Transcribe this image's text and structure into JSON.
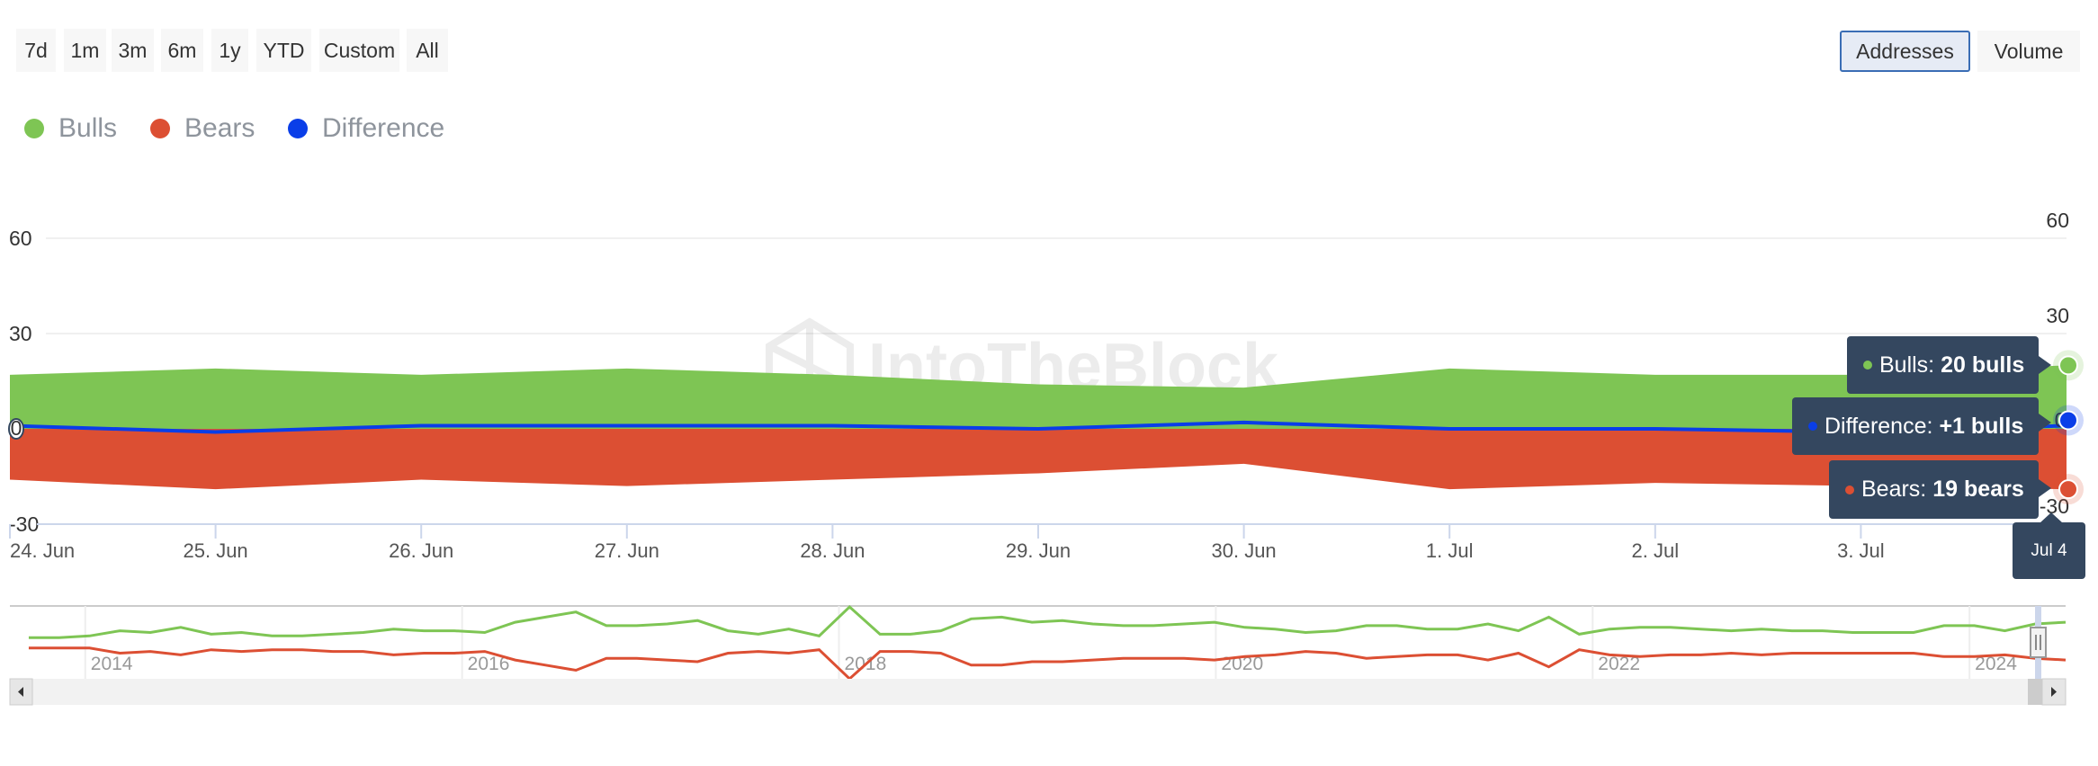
{
  "range_buttons": [
    {
      "label": "7d"
    },
    {
      "label": "1m"
    },
    {
      "label": "3m"
    },
    {
      "label": "6m"
    },
    {
      "label": "1y"
    },
    {
      "label": "YTD"
    },
    {
      "label": "Custom"
    },
    {
      "label": "All"
    }
  ],
  "mode_toggle": {
    "addresses_label": "Addresses",
    "volume_label": "Volume",
    "selected": "Addresses"
  },
  "colors": {
    "bulls": "#7ec554",
    "bears": "#dc4f33",
    "difference": "#0a3ee8",
    "tooltip_bg": "#34475f"
  },
  "legend": [
    {
      "name": "Bulls",
      "color": "#7ec554"
    },
    {
      "name": "Bears",
      "color": "#dc4f33"
    },
    {
      "name": "Difference",
      "color": "#0a3ee8"
    }
  ],
  "watermark": "IntoTheBlock",
  "tooltip": {
    "date": "Jul 4",
    "bulls_label": "Bulls:",
    "bulls_value": "20 bulls",
    "difference_label": "Difference:",
    "difference_value": "+1 bulls",
    "bears_label": "Bears:",
    "bears_value": "19 bears"
  },
  "chart_data": {
    "type": "area",
    "title": "",
    "xlabel": "",
    "ylabel": "",
    "x": [
      "24. Jun",
      "25. Jun",
      "26. Jun",
      "27. Jun",
      "28. Jun",
      "29. Jun",
      "30. Jun",
      "1. Jul",
      "2. Jul",
      "3. Jul",
      "4. Jul"
    ],
    "x_tick_labels": [
      "24. Jun",
      "25. Jun",
      "26. Jun",
      "27. Jun",
      "28. Jun",
      "29. Jun",
      "30. Jun",
      "1. Jul",
      "2. Jul",
      "3. Jul"
    ],
    "series": [
      {
        "name": "Bulls",
        "type": "area",
        "values": [
          17,
          19,
          17,
          19,
          17,
          14,
          13,
          19,
          17,
          17,
          20
        ]
      },
      {
        "name": "Bears",
        "type": "area",
        "values": [
          -16,
          -19,
          -16,
          -18,
          -16,
          -14,
          -11,
          -19,
          -17,
          -18,
          -19
        ]
      },
      {
        "name": "Difference",
        "type": "line",
        "values": [
          1,
          -1,
          1,
          1,
          1,
          0,
          2,
          0,
          0,
          -1,
          1
        ]
      }
    ],
    "y_ticks": [
      60,
      30,
      0,
      -30
    ],
    "ylim": [
      -30,
      60
    ],
    "right_axis_ticks": [
      60,
      30,
      0,
      -30
    ],
    "grid": true,
    "legend_position": "top-left",
    "navigator": {
      "year_labels": [
        "2014",
        "2016",
        "2018",
        "2020",
        "2022",
        "2024"
      ],
      "x_range": [
        2013.7,
        2024.51
      ],
      "bulls_approx": [
        2,
        2,
        3,
        6,
        5,
        8,
        4,
        5,
        3,
        3,
        4,
        5,
        7,
        6,
        6,
        5,
        11,
        14,
        17,
        9,
        9,
        10,
        12,
        6,
        4,
        7,
        3,
        20,
        4,
        4,
        6,
        13,
        14,
        11,
        12,
        10,
        9,
        9,
        10,
        11,
        8,
        7,
        5,
        6,
        9,
        9,
        7,
        7,
        10,
        6,
        14,
        4,
        7,
        8,
        8,
        7,
        6,
        7,
        6,
        6,
        5,
        5,
        5,
        9,
        9,
        6,
        10,
        11
      ],
      "bears_approx": [
        -2,
        -2,
        -2,
        -5,
        -4,
        -6,
        -3,
        -4,
        -3,
        -3,
        -4,
        -4,
        -6,
        -5,
        -5,
        -4,
        -9,
        -12,
        -15,
        -8,
        -8,
        -9,
        -10,
        -5,
        -4,
        -5,
        -3,
        -20,
        -4,
        -4,
        -5,
        -12,
        -12,
        -10,
        -10,
        -9,
        -8,
        -8,
        -8,
        -9,
        -7,
        -6,
        -4,
        -5,
        -8,
        -7,
        -6,
        -6,
        -9,
        -5,
        -13,
        -3,
        -6,
        -7,
        -6,
        -6,
        -5,
        -6,
        -5,
        -5,
        -5,
        -5,
        -5,
        -7,
        -7,
        -6,
        -8,
        -9
      ]
    }
  }
}
